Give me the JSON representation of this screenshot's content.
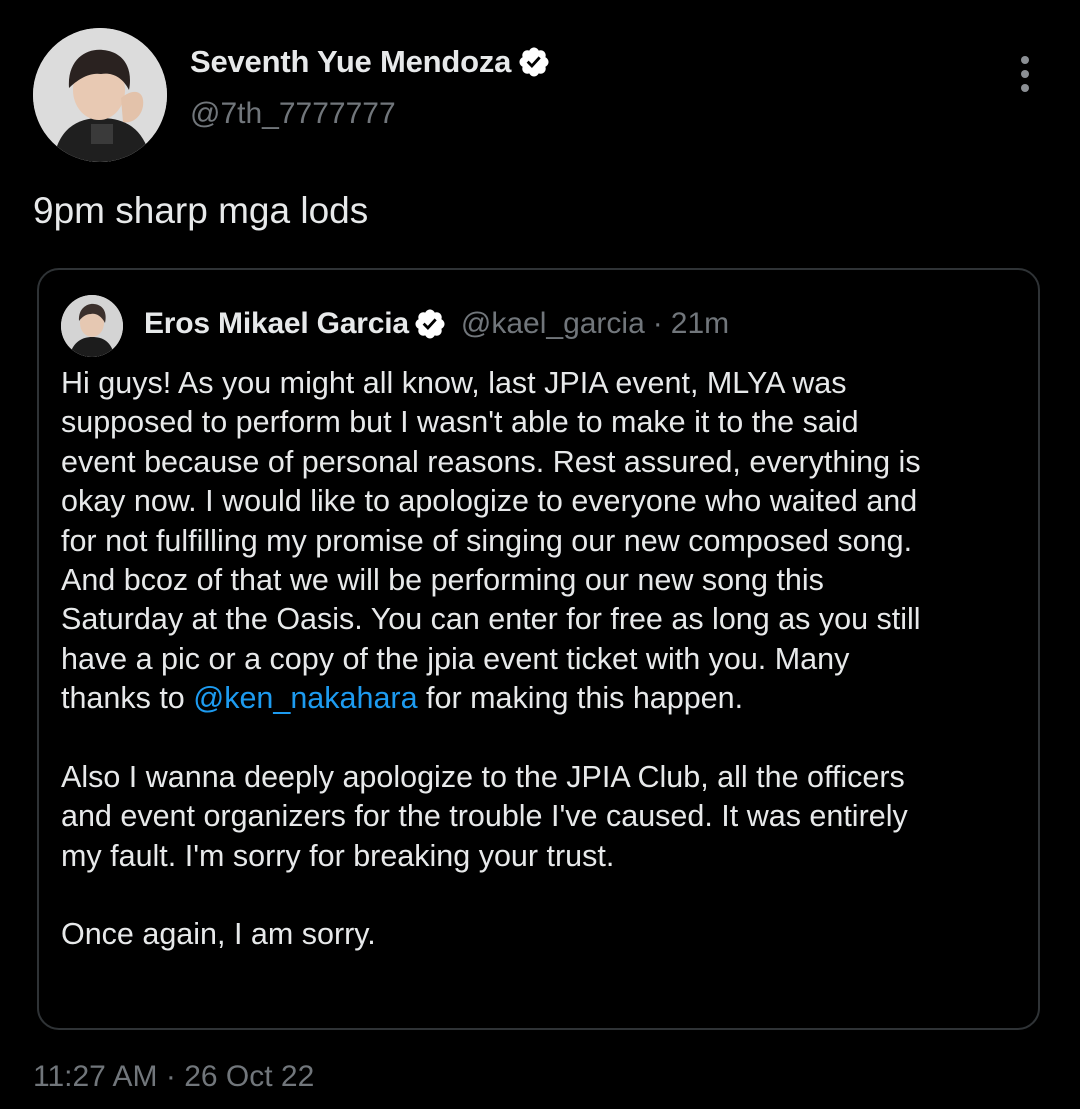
{
  "tweet": {
    "author_name": "Seventh Yue Mendoza",
    "author_handle": "@7th_7777777",
    "text": "9pm sharp mga lods",
    "time": "11:27 AM",
    "separator": "·",
    "date": "26 Oct 22",
    "icons": {
      "verified": "verified-badge-icon",
      "menu": "more-options-icon"
    }
  },
  "quote": {
    "author_name": "Eros Mikael Garcia",
    "author_handle": "@kael_garcia",
    "separator": "·",
    "time_ago": "21m",
    "para1": {
      "line1": "Hi guys! As you might all know, last JPIA event, MLYA was",
      "line2": "supposed to perform but I wasn't able to make it to the said",
      "line3": "event because of personal reasons. Rest assured, everything is",
      "line4": "okay now. I would like to apologize to everyone who waited and",
      "line5": "for not fulfilling my promise of singing our new composed song.",
      "line6": "And bcoz of that we will be performing our new song this",
      "line7": "Saturday at the Oasis. You can enter for free as long as you still",
      "line8": "have a pic or a copy of the jpia event ticket with you. Many",
      "line9_prefix": "thanks to ",
      "mention": "@ken_nakahara",
      "line9_suffix": " for making this happen."
    },
    "para2": {
      "line1": "Also I wanna deeply apologize to the JPIA Club, all the officers",
      "line2": "and event organizers for the trouble I've caused. It was entirely",
      "line3": "my fault. I'm sorry for breaking your trust."
    },
    "para3": {
      "line1": "Once again, I am sorry."
    }
  },
  "colors": {
    "background": "#000000",
    "text_primary": "#e7e9ea",
    "text_secondary": "#71767b",
    "link": "#1d9bf0",
    "border": "#2f3336"
  }
}
